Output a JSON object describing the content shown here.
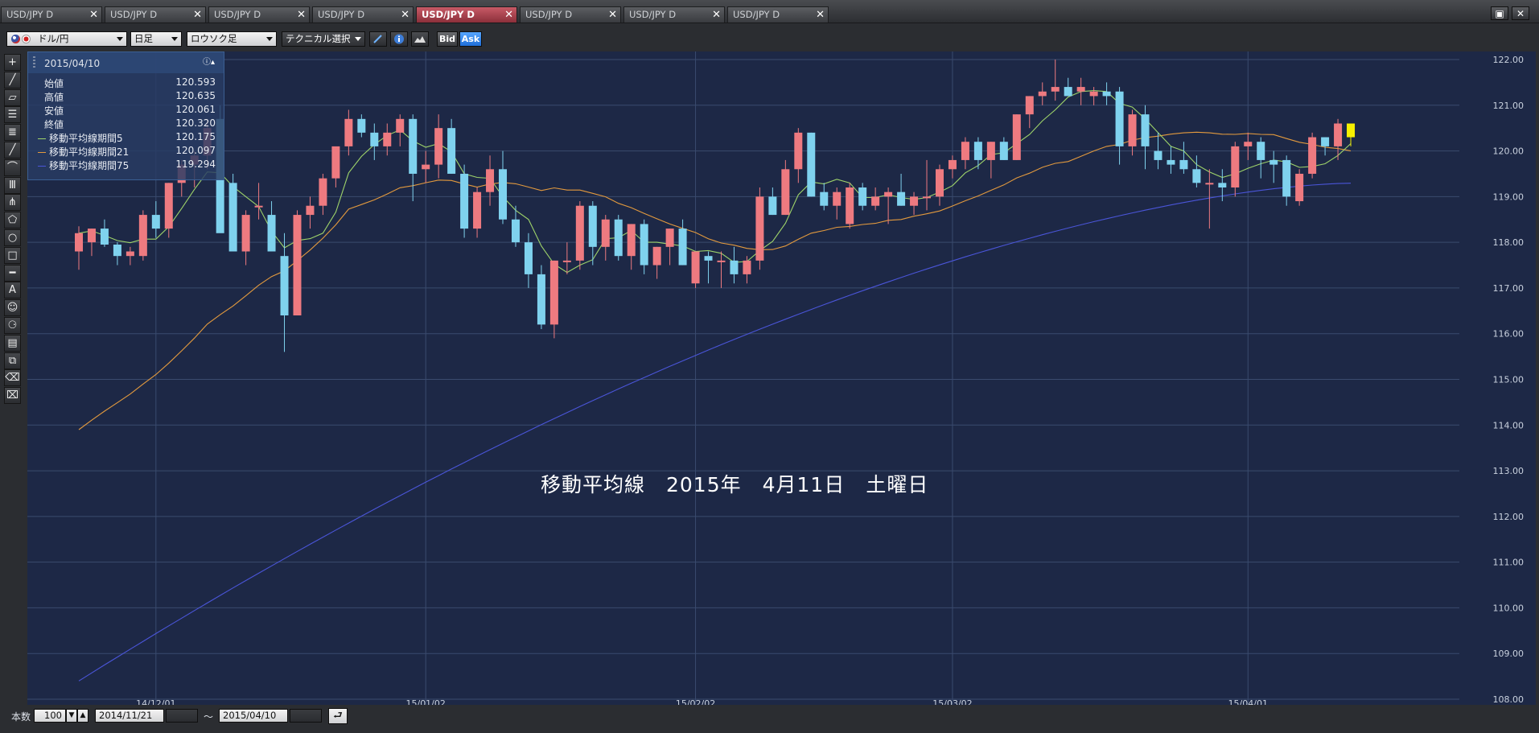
{
  "tabs": [
    {
      "label": "USD/JPY D"
    },
    {
      "label": "USD/JPY D"
    },
    {
      "label": "USD/JPY D"
    },
    {
      "label": "USD/JPY D"
    },
    {
      "label": "USD/JPY D",
      "active": true
    },
    {
      "label": "USD/JPY D"
    },
    {
      "label": "USD/JPY D"
    },
    {
      "label": "USD/JPY D"
    }
  ],
  "toolbar": {
    "pair_label": "ドル/円",
    "period_label": "日足",
    "chart_type_label": "ロウソク足",
    "technical_label": "テクニカル選択",
    "bid_label": "Bid",
    "ask_label": "Ask"
  },
  "info": {
    "date": "2015/04/10",
    "rows": [
      {
        "label": "始値",
        "value": "120.593"
      },
      {
        "label": "高値",
        "value": "120.635"
      },
      {
        "label": "安値",
        "value": "120.061"
      },
      {
        "label": "終値",
        "value": "120.320"
      },
      {
        "label": "移動平均線期間5",
        "value": "120.175"
      },
      {
        "label": "移動平均線期間21",
        "value": "120.097"
      },
      {
        "label": "移動平均線期間75",
        "value": "119.294"
      }
    ],
    "ma_colors": [
      "#9ed36a",
      "#e39a3e",
      "#4a55d8"
    ]
  },
  "overlay_text": "移動平均線　2015年　4月11日　土曜日",
  "bottom": {
    "count_label": "本数",
    "count_value": "100",
    "start_date": "2014/11/21",
    "tilde": "〜",
    "end_date": "2015/04/10"
  },
  "colors": {
    "up": "#ee7a80",
    "down": "#7fd2ee",
    "last": "#f7f000",
    "chart_bg": "#1d2846",
    "grid": "#3a4b6e"
  },
  "chart_data": {
    "type": "candlestick",
    "ylim": [
      108,
      122
    ],
    "y_ticks": [
      "122.00",
      "121.00",
      "120.00",
      "119.00",
      "118.00",
      "117.00",
      "116.00",
      "115.00",
      "114.00",
      "113.00",
      "112.00",
      "111.00",
      "110.00",
      "109.00",
      "108.00"
    ],
    "x_ticks": [
      "14/12/01",
      "15/01/02",
      "15/02/02",
      "15/03/02",
      "15/04/01"
    ],
    "x_tick_index": [
      6,
      27,
      48,
      68,
      91
    ],
    "ohlc": [
      [
        117.8,
        118.35,
        117.4,
        118.2
      ],
      [
        118.0,
        118.3,
        117.7,
        118.3
      ],
      [
        118.3,
        118.5,
        117.9,
        117.95
      ],
      [
        117.95,
        118.0,
        117.5,
        117.7
      ],
      [
        117.7,
        117.9,
        117.5,
        117.8
      ],
      [
        117.7,
        118.7,
        117.6,
        118.6
      ],
      [
        118.6,
        118.9,
        118.1,
        118.3
      ],
      [
        118.3,
        119.3,
        118.1,
        119.3
      ],
      [
        119.3,
        119.8,
        119.0,
        119.7
      ],
      [
        119.7,
        120.0,
        119.2,
        119.9
      ],
      [
        119.9,
        120.7,
        119.6,
        120.5
      ],
      [
        120.7,
        121.0,
        119.8,
        118.2
      ],
      [
        119.3,
        119.5,
        117.8,
        117.8
      ],
      [
        117.8,
        118.7,
        117.5,
        118.6
      ],
      [
        118.8,
        119.3,
        118.5,
        118.8
      ],
      [
        118.6,
        118.9,
        117.8,
        117.8
      ],
      [
        117.7,
        118.2,
        115.6,
        116.4
      ],
      [
        116.4,
        118.7,
        116.4,
        118.6
      ],
      [
        118.6,
        119.0,
        118.3,
        118.8
      ],
      [
        118.8,
        119.5,
        118.6,
        119.4
      ],
      [
        119.4,
        120.0,
        119.2,
        120.1
      ],
      [
        120.1,
        120.9,
        119.9,
        120.7
      ],
      [
        120.7,
        120.8,
        120.3,
        120.4
      ],
      [
        120.4,
        120.6,
        119.8,
        120.1
      ],
      [
        120.1,
        120.6,
        119.9,
        120.4
      ],
      [
        120.4,
        120.8,
        120.1,
        120.7
      ],
      [
        120.7,
        120.8,
        118.9,
        119.5
      ],
      [
        119.6,
        120.0,
        119.3,
        119.7
      ],
      [
        119.7,
        120.8,
        119.4,
        120.5
      ],
      [
        120.5,
        120.7,
        119.5,
        119.5
      ],
      [
        119.5,
        119.7,
        118.1,
        118.3
      ],
      [
        118.3,
        119.2,
        118.1,
        119.1
      ],
      [
        119.1,
        119.9,
        118.8,
        119.6
      ],
      [
        119.6,
        120.0,
        118.4,
        118.5
      ],
      [
        118.5,
        118.8,
        117.9,
        118.0
      ],
      [
        118.0,
        118.2,
        117.0,
        117.3
      ],
      [
        117.3,
        117.5,
        116.1,
        116.2
      ],
      [
        116.2,
        117.6,
        115.9,
        117.6
      ],
      [
        117.6,
        118.0,
        117.3,
        117.6
      ],
      [
        117.6,
        118.9,
        117.4,
        118.8
      ],
      [
        118.8,
        118.9,
        117.5,
        117.9
      ],
      [
        117.9,
        118.6,
        117.6,
        118.5
      ],
      [
        118.5,
        118.6,
        117.6,
        117.7
      ],
      [
        117.7,
        118.4,
        117.4,
        118.4
      ],
      [
        118.4,
        118.5,
        117.3,
        117.5
      ],
      [
        117.5,
        117.9,
        117.2,
        117.9
      ],
      [
        117.9,
        118.3,
        117.5,
        118.3
      ],
      [
        118.3,
        118.5,
        117.5,
        117.5
      ],
      [
        117.1,
        117.8,
        117.0,
        117.8
      ],
      [
        117.7,
        117.8,
        117.1,
        117.6
      ],
      [
        117.6,
        117.8,
        117.0,
        117.6
      ],
      [
        117.6,
        117.9,
        117.1,
        117.3
      ],
      [
        117.3,
        117.7,
        117.1,
        117.6
      ],
      [
        117.6,
        119.2,
        117.4,
        119.0
      ],
      [
        119.0,
        119.2,
        118.6,
        118.6
      ],
      [
        118.6,
        119.8,
        118.6,
        119.6
      ],
      [
        119.6,
        120.5,
        119.3,
        120.4
      ],
      [
        120.4,
        120.4,
        119.0,
        119.0
      ],
      [
        119.1,
        119.3,
        118.7,
        118.8
      ],
      [
        118.8,
        119.2,
        118.5,
        119.1
      ],
      [
        118.4,
        119.3,
        118.3,
        119.2
      ],
      [
        119.2,
        119.3,
        118.7,
        118.8
      ],
      [
        118.8,
        119.2,
        118.7,
        119.0
      ],
      [
        119.0,
        119.2,
        118.4,
        119.1
      ],
      [
        119.1,
        119.5,
        118.8,
        118.8
      ],
      [
        118.8,
        119.1,
        118.6,
        119.0
      ],
      [
        119.0,
        119.8,
        118.7,
        119.0
      ],
      [
        119.0,
        119.7,
        118.8,
        119.6
      ],
      [
        119.6,
        119.9,
        119.4,
        119.8
      ],
      [
        119.8,
        120.3,
        119.6,
        120.2
      ],
      [
        120.2,
        120.3,
        119.6,
        119.8
      ],
      [
        119.8,
        120.2,
        119.4,
        120.2
      ],
      [
        120.2,
        120.3,
        119.8,
        119.8
      ],
      [
        119.8,
        120.8,
        119.8,
        120.8
      ],
      [
        120.8,
        121.2,
        120.5,
        121.2
      ],
      [
        121.2,
        121.5,
        121.0,
        121.3
      ],
      [
        121.3,
        122.0,
        121.1,
        121.4
      ],
      [
        121.4,
        121.6,
        121.2,
        121.2
      ],
      [
        121.3,
        121.6,
        121.0,
        121.4
      ],
      [
        121.2,
        121.4,
        121.0,
        121.3
      ],
      [
        121.3,
        121.5,
        121.0,
        121.2
      ],
      [
        121.3,
        121.4,
        119.7,
        120.1
      ],
      [
        120.1,
        120.9,
        119.9,
        120.8
      ],
      [
        120.8,
        121.0,
        119.6,
        120.1
      ],
      [
        120.0,
        120.4,
        119.6,
        119.8
      ],
      [
        119.8,
        120.1,
        119.5,
        119.7
      ],
      [
        119.8,
        120.2,
        119.5,
        119.6
      ],
      [
        119.6,
        119.9,
        119.2,
        119.3
      ],
      [
        119.3,
        119.6,
        118.3,
        119.3
      ],
      [
        119.3,
        119.6,
        118.9,
        119.2
      ],
      [
        119.2,
        120.2,
        119.0,
        120.1
      ],
      [
        120.1,
        120.4,
        119.8,
        120.2
      ],
      [
        120.2,
        120.3,
        119.4,
        119.8
      ],
      [
        119.8,
        120.0,
        119.3,
        119.7
      ],
      [
        119.8,
        119.9,
        118.8,
        119.0
      ],
      [
        118.9,
        119.6,
        118.8,
        119.5
      ],
      [
        119.5,
        120.4,
        119.4,
        120.3
      ],
      [
        120.3,
        120.3,
        119.9,
        120.1
      ],
      [
        120.1,
        120.7,
        119.8,
        120.6
      ],
      [
        120.6,
        120.6,
        120.1,
        120.3
      ]
    ],
    "ma5_end": 120.175,
    "ma21_end": 120.097,
    "ma75_start": 108.4,
    "ma75_end": 119.294,
    "ma21_start": 113.9
  }
}
